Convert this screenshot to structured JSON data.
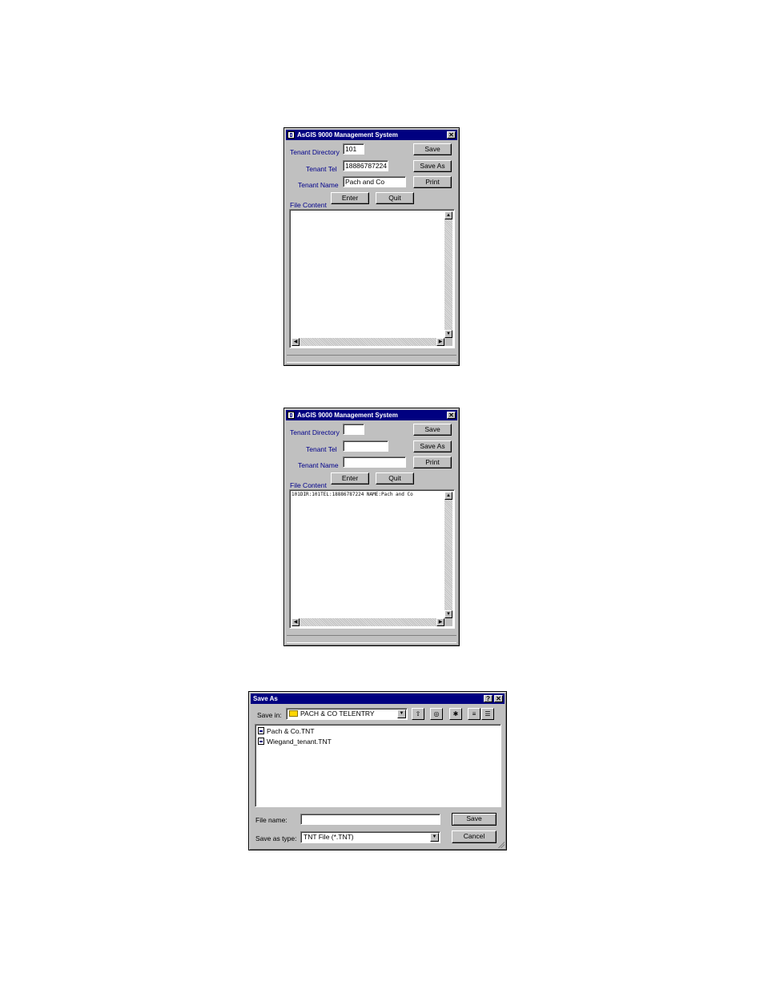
{
  "window1": {
    "title": "AsGIS 9000 Management System",
    "close_glyph": "✕",
    "labels": {
      "directory": "Tenant Directory",
      "tel": "Tenant Tel",
      "name": "Tenant Name",
      "file_content": "File Content"
    },
    "values": {
      "directory": "101",
      "tel": "18886787224",
      "name": "Pach and Co"
    },
    "buttons": {
      "save": "Save",
      "save_as": "Save As",
      "print": "Print",
      "enter": "Enter",
      "quit": "Quit"
    },
    "memo_text": ""
  },
  "window2": {
    "title": "AsGIS 9000 Management System",
    "close_glyph": "✕",
    "labels": {
      "directory": "Tenant Directory",
      "tel": "Tenant Tel",
      "name": "Tenant Name",
      "file_content": "File Content"
    },
    "values": {
      "directory": "",
      "tel": "",
      "name": ""
    },
    "buttons": {
      "save": "Save",
      "save_as": "Save As",
      "print": "Print",
      "enter": "Enter",
      "quit": "Quit"
    },
    "memo_text": "101DIR:101TEL:18886787224 NAME:Pach and Co"
  },
  "save_dialog": {
    "title": "Save As",
    "help_glyph": "?",
    "close_glyph": "✕",
    "save_in_label": "Save in:",
    "save_in_value": "PACH & CO TELENTRY",
    "files": [
      "Pach & Co.TNT",
      "Wiegand_tenant.TNT"
    ],
    "file_name_label": "File name:",
    "file_name_value": "",
    "save_as_type_label": "Save as type:",
    "save_as_type_value": "TNT File (*.TNT)",
    "save_button": "Save",
    "cancel_button": "Cancel"
  },
  "icons": {
    "up_arrow": "▲",
    "down_arrow": "▼",
    "left_arrow": "◀",
    "right_arrow": "▶",
    "drop_arrow": "▼",
    "up_folder": "⇧",
    "desktop": "◎",
    "new_folder": "✱",
    "list_view": "≡",
    "details_view": "☰"
  }
}
